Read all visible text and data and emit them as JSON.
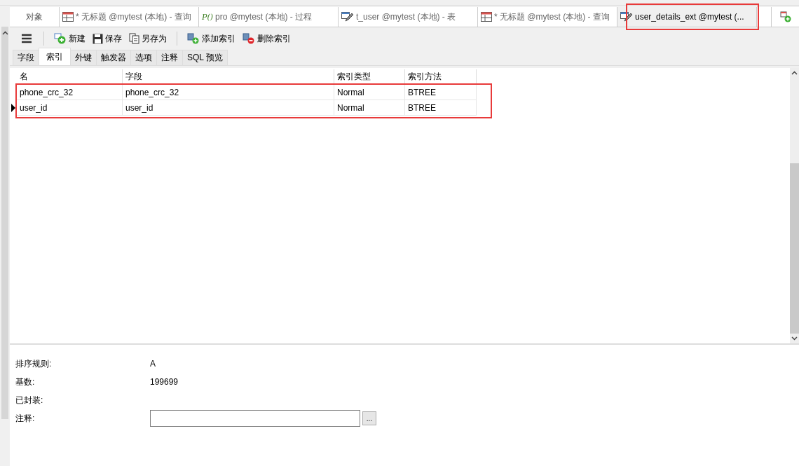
{
  "object_tab": {
    "label": "对象"
  },
  "tabs": [
    {
      "label": "* 无标题 @mytest (本地) - 查询",
      "kind": "query",
      "selected": false
    },
    {
      "label": "pro @mytest (本地) - 过程",
      "kind": "procedure",
      "icon": "P()",
      "selected": false
    },
    {
      "label": "t_user @mytest (本地) - 表",
      "kind": "design",
      "selected": false
    },
    {
      "label": "* 无标题 @mytest (本地) - 查询",
      "kind": "query",
      "selected": false
    },
    {
      "label": "user_details_ext @mytest (...",
      "kind": "design",
      "selected": true
    }
  ],
  "toolbar": [
    {
      "label": "新建",
      "kind": "new"
    },
    {
      "label": "保存",
      "kind": "save"
    },
    {
      "label": "另存为",
      "kind": "saveas"
    },
    {
      "label": "添加索引",
      "kind": "add"
    },
    {
      "label": "删除索引",
      "kind": "delete"
    }
  ],
  "subtabs": [
    {
      "label": "字段",
      "selected": false
    },
    {
      "label": "索引",
      "selected": true
    },
    {
      "label": "外键",
      "selected": false
    },
    {
      "label": "触发器",
      "selected": false
    },
    {
      "label": "选项",
      "selected": false
    },
    {
      "label": "注释",
      "selected": false
    },
    {
      "label": "SQL 预览",
      "selected": false
    }
  ],
  "table": {
    "columns": [
      "名",
      "字段",
      "索引类型",
      "索引方法"
    ],
    "rows": [
      {
        "cells": [
          "phone_crc_32",
          "phone_crc_32",
          "Normal",
          "BTREE"
        ],
        "current": false
      },
      {
        "cells": [
          "user_id",
          "user_id",
          "Normal",
          "BTREE"
        ],
        "current": true
      }
    ]
  },
  "properties": [
    {
      "label": "排序规则:",
      "value": "A",
      "kind": "text"
    },
    {
      "label": "基数:",
      "value": "199699",
      "kind": "text"
    },
    {
      "label": "已封装:",
      "kind": "text"
    },
    {
      "label": "注释:",
      "kind": "field",
      "button": "..."
    }
  ]
}
